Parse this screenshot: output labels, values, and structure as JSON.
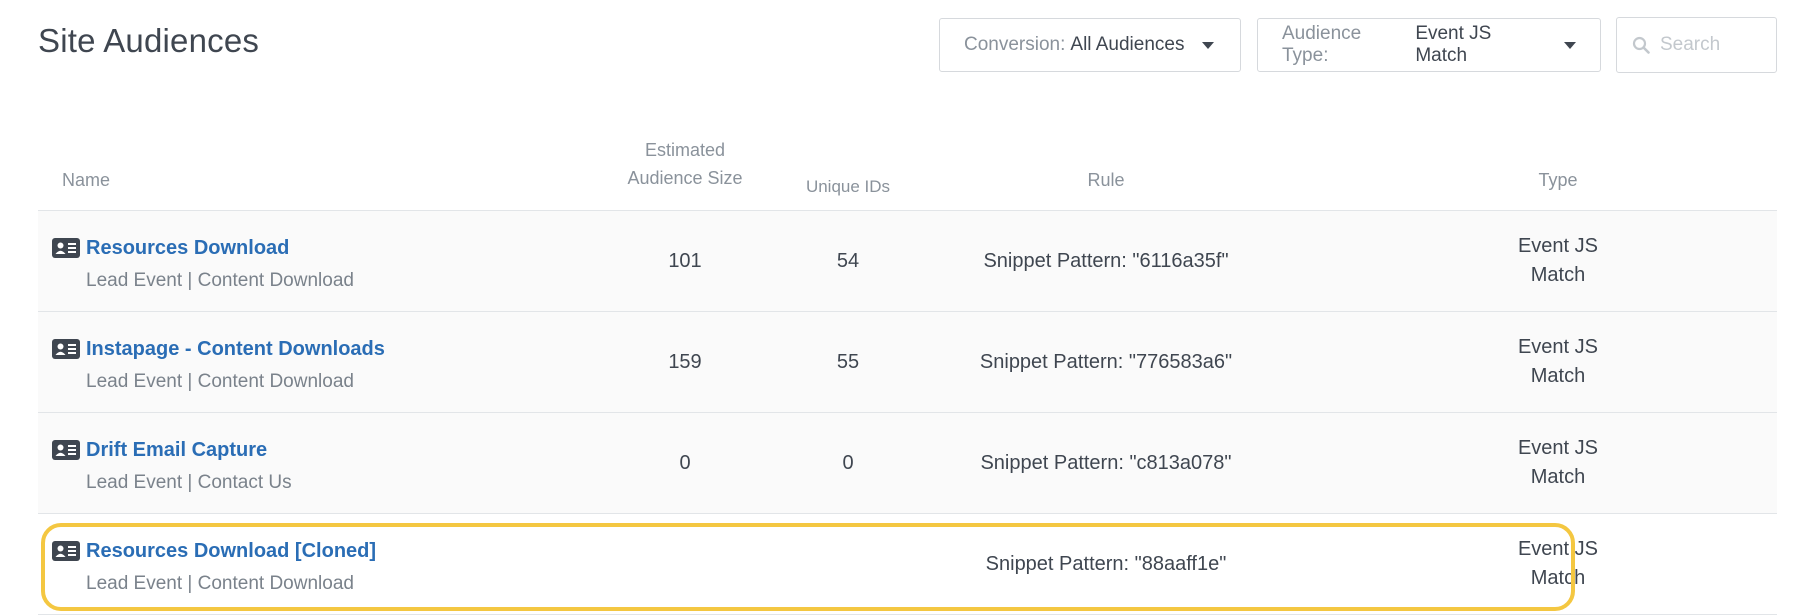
{
  "page": {
    "title": "Site Audiences"
  },
  "filters": {
    "conversion": {
      "label": "Conversion:",
      "value": "All Audiences"
    },
    "audience_type": {
      "label": "Audience Type:",
      "value": "Event JS Match"
    }
  },
  "search": {
    "placeholder": "Search"
  },
  "table": {
    "headers": {
      "name": "Name",
      "size_line1": "Estimated",
      "size_line2": "Audience Size",
      "unique": "Unique IDs",
      "rule": "Rule",
      "type": "Type"
    },
    "rows": [
      {
        "name": "Resources Download",
        "subtitle": "Lead Event | Content Download",
        "size": "101",
        "unique": "54",
        "rule": "Snippet Pattern: \"6116a35f\"",
        "type_line1": "Event JS",
        "type_line2": "Match"
      },
      {
        "name": "Instapage - Content Downloads",
        "subtitle": "Lead Event | Content Download",
        "size": "159",
        "unique": "55",
        "rule": "Snippet Pattern: \"776583a6\"",
        "type_line1": "Event JS",
        "type_line2": "Match"
      },
      {
        "name": "Drift Email Capture",
        "subtitle": "Lead Event | Contact Us",
        "size": "0",
        "unique": "0",
        "rule": "Snippet Pattern: \"c813a078\"",
        "type_line1": "Event JS",
        "type_line2": "Match"
      },
      {
        "name": "Resources Download [Cloned]",
        "subtitle": "Lead Event | Content Download",
        "size": "",
        "unique": "",
        "rule": "Snippet Pattern: \"88aaff1e\"",
        "type_line1": "Event JS",
        "type_line2": "Match"
      }
    ]
  },
  "colors": {
    "link": "#2a6db5",
    "highlight_border": "#f4c741",
    "muted": "#8a929b"
  }
}
